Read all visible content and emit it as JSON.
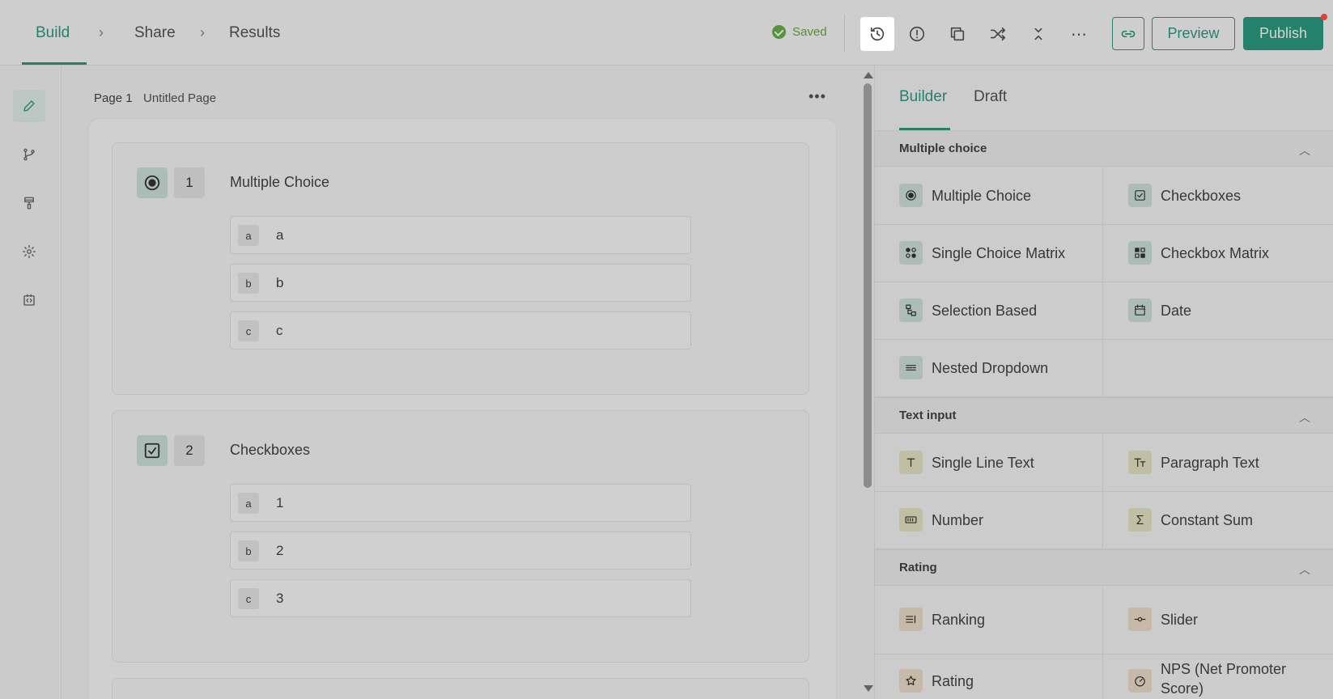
{
  "nav": {
    "build": "Build",
    "share": "Share",
    "results": "Results",
    "saved": "Saved",
    "preview": "Preview",
    "publish": "Publish",
    "more_icon": "⋯"
  },
  "canvas": {
    "page_label": "Page 1",
    "page_name": "Untitled Page",
    "more": "•••",
    "questions": [
      {
        "type_icon": "radio-icon",
        "number": "1",
        "title": "Multiple Choice",
        "options": [
          {
            "key": "a",
            "value": "a"
          },
          {
            "key": "b",
            "value": "b"
          },
          {
            "key": "c",
            "value": "c"
          }
        ]
      },
      {
        "type_icon": "checkbox-icon",
        "number": "2",
        "title": "Checkboxes",
        "options": [
          {
            "key": "a",
            "value": "1"
          },
          {
            "key": "b",
            "value": "2"
          },
          {
            "key": "c",
            "value": "3"
          }
        ]
      }
    ]
  },
  "panel": {
    "tabs": [
      "Builder",
      "Draft"
    ],
    "sections": [
      {
        "label": "Multiple choice",
        "items": [
          "Multiple Choice",
          "Checkboxes",
          "Single Choice Matrix",
          "Checkbox Matrix",
          "Selection Based",
          "Date",
          "Nested Dropdown"
        ]
      },
      {
        "label": "Text input",
        "items": [
          "Single Line Text",
          "Paragraph Text",
          "Number",
          "Constant Sum"
        ]
      },
      {
        "label": "Rating",
        "items": [
          "Ranking",
          "Slider",
          "Rating",
          "NPS (Net Promoter Score)"
        ]
      }
    ]
  },
  "colors": {
    "accent": "#2c9c83",
    "saved": "#6ab04c",
    "notification": "#e0403a"
  }
}
